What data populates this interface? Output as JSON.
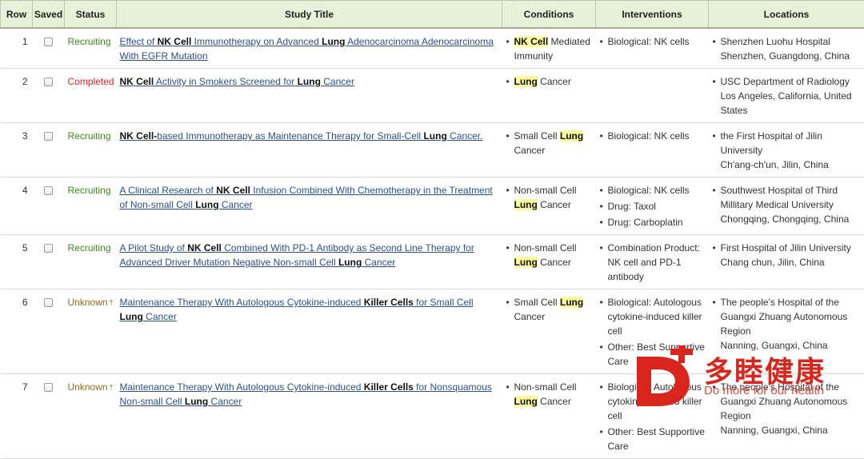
{
  "columns": [
    "Row",
    "Saved",
    "Status",
    "Study Title",
    "Conditions",
    "Interventions",
    "Locations"
  ],
  "rows": [
    {
      "row": "1",
      "status": "Recruiting",
      "status_class": "recruiting",
      "title": [
        "Effect of ",
        {
          "b": "NK Cell"
        },
        " Immunotherapy on Advanced ",
        {
          "b": "Lung"
        },
        " Adenocarcinoma Adenocarcinoma With EGFR Mutation"
      ],
      "conditions": [
        [
          "",
          {
            "h": "NK Cell"
          },
          " Mediated Immunity"
        ]
      ],
      "interventions": [
        "Biological: NK cells"
      ],
      "locations": [
        [
          "Shenzhen Luohu Hospital",
          "Shenzhen, Guangdong, China"
        ]
      ]
    },
    {
      "row": "2",
      "status": "Completed",
      "status_class": "completed",
      "title": [
        {
          "b": "NK Cell"
        },
        " Activity in Smokers Screened for ",
        {
          "b": "Lung"
        },
        " Cancer"
      ],
      "conditions": [
        [
          "",
          {
            "h": "Lung"
          },
          " Cancer"
        ]
      ],
      "interventions": [],
      "locations": [
        [
          "USC Department of Radiology",
          "Los Angeles, California, United States"
        ]
      ]
    },
    {
      "row": "3",
      "status": "Recruiting",
      "status_class": "recruiting",
      "title": [
        {
          "b": "NK Cell-"
        },
        "based Immunotherapy as Maintenance Therapy for Small-Cell ",
        {
          "b": "Lung"
        },
        " Cancer."
      ],
      "conditions": [
        [
          "Small Cell ",
          {
            "h": "Lung"
          },
          " Cancer"
        ]
      ],
      "interventions": [
        "Biological: NK cells"
      ],
      "locations": [
        [
          "the First Hospital of Jilin University",
          "Ch'ang-ch'un, Jilin, China"
        ]
      ]
    },
    {
      "row": "4",
      "status": "Recruiting",
      "status_class": "recruiting",
      "title": [
        "A Clinical Research of ",
        {
          "b": "NK Cell"
        },
        " Infusion Combined With Chemotherapy in the Treatment of Non-small Cell ",
        {
          "b": "Lung"
        },
        " Cancer"
      ],
      "conditions": [
        [
          "Non-small Cell ",
          {
            "h": "Lung"
          },
          " Cancer"
        ]
      ],
      "interventions": [
        "Biological: NK cells",
        "Drug: Taxol",
        "Drug: Carboplatin"
      ],
      "locations": [
        [
          "Southwest Hospital of Third Millitary Medical University",
          "Chongqing, Chongqing, China"
        ]
      ]
    },
    {
      "row": "5",
      "status": "Recruiting",
      "status_class": "recruiting",
      "title": [
        "A Pilot Study of ",
        {
          "b": "NK Cell"
        },
        " Combined With PD-1 Antibody as Second Line Therapy for Advanced Driver Mutation Negative Non-small Cell ",
        {
          "b": "Lung"
        },
        " Cancer"
      ],
      "conditions": [
        [
          "Non-small Cell ",
          {
            "h": "Lung"
          },
          " Cancer"
        ]
      ],
      "interventions": [
        "Combination Product: NK cell and PD-1 antibody"
      ],
      "locations": [
        [
          "First Hospital of Jilin University",
          "Chang chun, Jilin, China"
        ]
      ]
    },
    {
      "row": "6",
      "status": "Unknown",
      "status_class": "unknown",
      "status_mark": "†",
      "title": [
        "Maintenance Therapy With Autologous Cytokine-induced ",
        {
          "b": "Killer Cells"
        },
        " for Small Cell ",
        {
          "b": "Lung"
        },
        " Cancer"
      ],
      "conditions": [
        [
          "Small Cell ",
          {
            "h": "Lung"
          },
          " Cancer"
        ]
      ],
      "interventions": [
        "Biological: Autologous cytokine-induced killer cell",
        "Other: Best Supportive Care"
      ],
      "locations": [
        [
          "The people's Hospital of the Guangxi Zhuang Autonomous Region",
          "Nanning, Guangxi, China"
        ]
      ]
    },
    {
      "row": "7",
      "status": "Unknown",
      "status_class": "unknown",
      "status_mark": "†",
      "title": [
        "Maintenance Therapy With Autologous Cytokine-induced ",
        {
          "b": "Killer Cells"
        },
        " for Nonsquamous Non-small Cell ",
        {
          "b": "Lung"
        },
        " Cancer"
      ],
      "conditions": [
        [
          "Non-small Cell ",
          {
            "h": "Lung"
          },
          " Cancer"
        ]
      ],
      "interventions": [
        "Biological: Autologous cytokine-induced killer cell",
        "Other: Best Supportive Care"
      ],
      "locations": [
        [
          "The people's Hospital of the Guangxi Zhuang Autonomous Region",
          "Nanning, Guangxi, China"
        ]
      ]
    }
  ],
  "watermark": {
    "brand": "多睦健康",
    "slogan": "Do more for our health",
    "color": "#d9261c"
  },
  "colors": {
    "header_bg": "#e7f0d9",
    "link": "#2a4f8f",
    "recruiting": "#3b8a1a",
    "completed": "#e02020",
    "unknown": "#8a6d1a",
    "highlight": "#fbfb9a"
  }
}
